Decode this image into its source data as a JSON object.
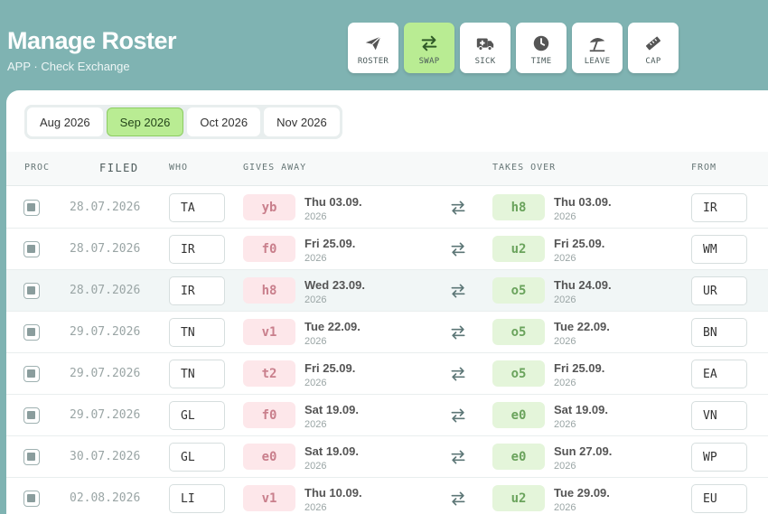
{
  "header": {
    "title": "Manage Roster",
    "subtitle": "APP · Check Exchange"
  },
  "nav": [
    {
      "label": "ROSTER",
      "icon": "paper-plane-icon",
      "active": false
    },
    {
      "label": "SWAP",
      "icon": "swap-arrows-icon",
      "active": true
    },
    {
      "label": "SICK",
      "icon": "ambulance-icon",
      "active": false
    },
    {
      "label": "TIME",
      "icon": "clock-icon",
      "active": false
    },
    {
      "label": "LEAVE",
      "icon": "beach-umbrella-icon",
      "active": false
    },
    {
      "label": "CAP",
      "icon": "ruler-icon",
      "active": false
    }
  ],
  "months": [
    {
      "label": "Aug 2026",
      "active": false
    },
    {
      "label": "Sep 2026",
      "active": true
    },
    {
      "label": "Oct 2026",
      "active": false
    },
    {
      "label": "Nov 2026",
      "active": false
    }
  ],
  "columns": {
    "proc": "PROC",
    "filed": "FILED",
    "who": "WHO",
    "gives": "GIVES AWAY",
    "takes": "TAKES OVER",
    "from": "FROM"
  },
  "rows": [
    {
      "filed": "28.07.2026",
      "who": "TA",
      "give_code": "yb",
      "give_day": "Thu 03.09.",
      "give_year": "2026",
      "take_code": "h8",
      "take_day": "Thu 03.09.",
      "take_year": "2026",
      "from": "IR"
    },
    {
      "filed": "28.07.2026",
      "who": "IR",
      "give_code": "f0",
      "give_day": "Fri 25.09.",
      "give_year": "2026",
      "take_code": "u2",
      "take_day": "Fri 25.09.",
      "take_year": "2026",
      "from": "WM"
    },
    {
      "filed": "28.07.2026",
      "who": "IR",
      "give_code": "h8",
      "give_day": "Wed 23.09.",
      "give_year": "2026",
      "take_code": "o5",
      "take_day": "Thu 24.09.",
      "take_year": "2026",
      "from": "UR"
    },
    {
      "filed": "29.07.2026",
      "who": "TN",
      "give_code": "v1",
      "give_day": "Tue 22.09.",
      "give_year": "2026",
      "take_code": "o5",
      "take_day": "Tue 22.09.",
      "take_year": "2026",
      "from": "BN"
    },
    {
      "filed": "29.07.2026",
      "who": "TN",
      "give_code": "t2",
      "give_day": "Fri 25.09.",
      "give_year": "2026",
      "take_code": "o5",
      "take_day": "Fri 25.09.",
      "take_year": "2026",
      "from": "EA"
    },
    {
      "filed": "29.07.2026",
      "who": "GL",
      "give_code": "f0",
      "give_day": "Sat 19.09.",
      "give_year": "2026",
      "take_code": "e0",
      "take_day": "Sat 19.09.",
      "take_year": "2026",
      "from": "VN"
    },
    {
      "filed": "30.07.2026",
      "who": "GL",
      "give_code": "e0",
      "give_day": "Sat 19.09.",
      "give_year": "2026",
      "take_code": "e0",
      "take_day": "Sun 27.09.",
      "take_year": "2026",
      "from": "WP"
    },
    {
      "filed": "02.08.2026",
      "who": "LI",
      "give_code": "v1",
      "give_day": "Thu 10.09.",
      "give_year": "2026",
      "take_code": "u2",
      "take_day": "Tue 29.09.",
      "take_year": "2026",
      "from": "EU"
    }
  ],
  "colors": {
    "background": "#7fb3b2",
    "active_accent": "#b9ec93",
    "give_badge": "#fde7ea",
    "take_badge": "#e4f5da"
  }
}
